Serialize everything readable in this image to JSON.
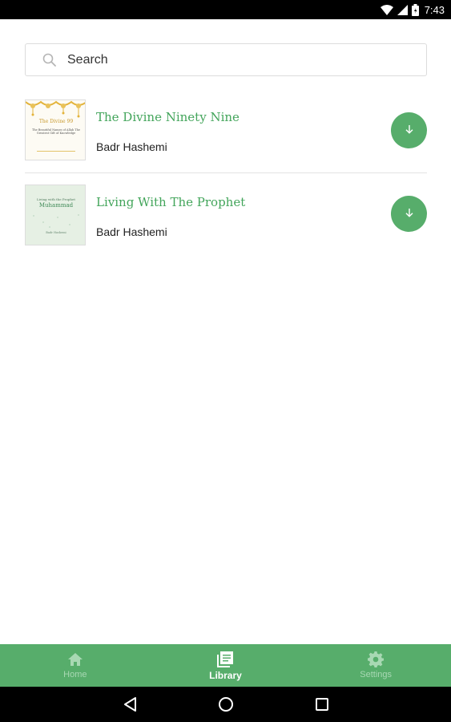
{
  "status_bar": {
    "time": "7:43",
    "icons": [
      "wifi-icon",
      "signal-icon",
      "battery-icon"
    ]
  },
  "search": {
    "placeholder": "Search",
    "icon": "search-icon"
  },
  "books": [
    {
      "title": "The Divine Ninety Nine",
      "author": "Badr Hashemi",
      "cover": {
        "title": "The Divine 99",
        "subtitle": "The Beautiful Names of Allah The Greatest Gift of Knowledge"
      },
      "action_icon": "download-icon"
    },
    {
      "title": "Living With The Prophet",
      "author": "Badr Hashemi",
      "cover": {
        "title": "Living with the Prophet",
        "subtitle": "Muhammad",
        "footer": "Badr Hashemi"
      },
      "action_icon": "download-icon"
    }
  ],
  "bottom_nav": {
    "items": [
      {
        "label": "Home",
        "icon": "home-icon",
        "active": false
      },
      {
        "label": "Library",
        "icon": "library-icon",
        "active": true
      },
      {
        "label": "Settings",
        "icon": "gear-icon",
        "active": false
      }
    ]
  },
  "system_nav": [
    "back-icon",
    "home-circle-icon",
    "recents-icon"
  ],
  "colors": {
    "accent": "#57ad6b",
    "title_green": "#43a55b",
    "nav_inactive": "#a8d8b3",
    "status_bar": "#000000"
  }
}
